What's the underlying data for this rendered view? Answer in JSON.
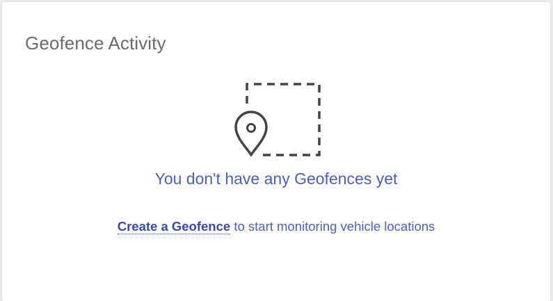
{
  "card": {
    "title": "Geofence Activity"
  },
  "empty_state": {
    "icon": "geofence-map-pin-icon",
    "heading": "You don't have any Geofences yet",
    "link_label": "Create a Geofence",
    "rest_text": " to start monitoring vehicle locations"
  },
  "colors": {
    "accent": "#4a5fc1",
    "link": "#3949ab",
    "title": "#6b6b6b",
    "icon": "#444444"
  }
}
